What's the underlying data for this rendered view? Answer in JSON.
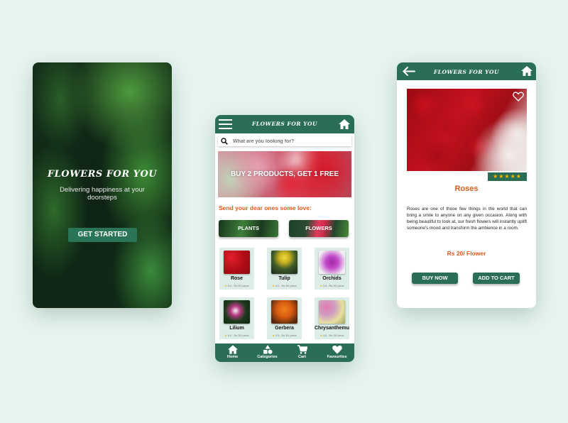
{
  "colors": {
    "background": "#e7f5f0",
    "primary_green": "#2a6f55",
    "accent_orange": "#e05a1c",
    "star_yellow": "#f5b800"
  },
  "splash": {
    "title": "FLOWERS FOR YOU",
    "subtitle": "Delivering happiness at your doorsteps",
    "cta_label": "GET STARTED"
  },
  "home": {
    "header": {
      "menu_icon": "hamburger-icon",
      "title": "FLOWERS FOR YOU",
      "home_icon": "home-icon"
    },
    "search": {
      "icon": "search-icon",
      "placeholder": "What are you looking for?",
      "value": ""
    },
    "banner_text": "BUY 2 PRODUCTS, GET 1 FREE",
    "section_title": "Send your dear ones some love:",
    "categories": [
      {
        "label": "PLANTS"
      },
      {
        "label": "FLOWERS"
      }
    ],
    "products": [
      {
        "name": "Rose",
        "rating": "5.0",
        "price": "Rs 20/ piece"
      },
      {
        "name": "Tulip",
        "rating": "4.0",
        "price": "Rs 35/ piece"
      },
      {
        "name": "Orchids",
        "rating": "3.5",
        "price": "Rs 20/ piece"
      },
      {
        "name": "Lilium",
        "rating": "5.0",
        "price": "Rs 35/ piece"
      },
      {
        "name": "Gerbera",
        "rating": "4.5",
        "price": "Rs 30/ piece"
      },
      {
        "name": "Chrysanthemu",
        "rating": "4.0",
        "price": "Rs 15/ piece"
      }
    ],
    "bottom_nav": [
      {
        "label": "Home",
        "icon": "home-icon"
      },
      {
        "label": "Categories",
        "icon": "shapes-icon"
      },
      {
        "label": "Cart",
        "icon": "cart-icon"
      },
      {
        "label": "Favourites",
        "icon": "heart-icon"
      }
    ]
  },
  "detail": {
    "header": {
      "back_icon": "arrow-left-icon",
      "title": "FLOWERS FOR YOU",
      "home_icon": "home-icon"
    },
    "favourite_icon": "heart-outline-icon",
    "rating_stars": "★★★★★",
    "rating_value": 5,
    "product_name": "Roses",
    "description": "Roses are one of those few things in the world that can bring a smile to anyone on any given occasion. Along with being beautiful to look at, our fresh flowers will instantly uplift someone's mood and transform the ambience in a room.",
    "price": "Rs 20/ Flower",
    "buy_now_label": "BUY NOW",
    "add_to_cart_label": "ADD TO CART"
  }
}
